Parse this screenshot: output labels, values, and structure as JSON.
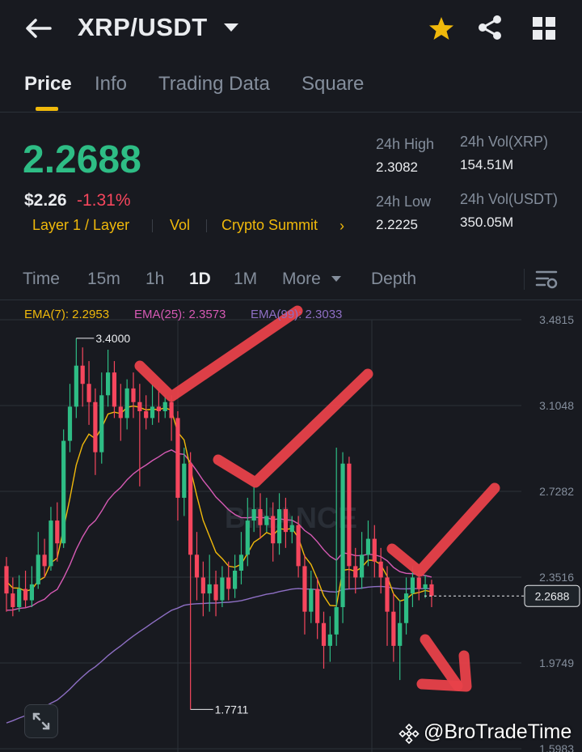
{
  "header": {
    "pair": "XRP/USDT"
  },
  "tabs": [
    "Price",
    "Info",
    "Trading Data",
    "Square"
  ],
  "price": {
    "last": "2.2688",
    "usd": "$2.26",
    "change": "-1.31%",
    "tags": [
      "Layer 1 / Layer",
      "Vol",
      "Crypto Summit"
    ]
  },
  "stats": {
    "high_label": "24h High",
    "high": "2.3082",
    "low_label": "24h Low",
    "low": "2.2225",
    "vol_base_label": "24h Vol(XRP)",
    "vol_base": "154.51M",
    "vol_quote_label": "24h Vol(USDT)",
    "vol_quote": "350.05M"
  },
  "intervals": [
    "Time",
    "15m",
    "1h",
    "1D",
    "1M",
    "More",
    "Depth"
  ],
  "active_interval": "1D",
  "ema": {
    "ema7": "EMA(7): 2.2953",
    "ema25": "EMA(25): 2.3573",
    "ema99": "EMA(99): 2.3033"
  },
  "colors": {
    "up": "#2ebd85",
    "down": "#f6465d",
    "accent": "#f0b90b",
    "annot": "#e8414a"
  },
  "chart_data": {
    "type": "candlestick",
    "y_ticks": [
      "3.4815",
      "3.1048",
      "2.7282",
      "2.3516",
      "1.9749",
      "1.5983"
    ],
    "ylim": [
      1.5983,
      3.4815
    ],
    "high_label": "3.4000",
    "low_label": "1.7711",
    "current_price": "2.2688",
    "watermark": "BINANCE",
    "candles": [
      [
        2.4,
        2.28,
        2.44,
        2.2
      ],
      [
        2.28,
        2.22,
        2.35,
        2.18
      ],
      [
        2.22,
        2.3,
        2.36,
        2.2
      ],
      [
        2.3,
        2.25,
        2.38,
        2.22
      ],
      [
        2.25,
        2.32,
        2.4,
        2.22
      ],
      [
        2.32,
        2.45,
        2.55,
        2.3
      ],
      [
        2.45,
        2.4,
        2.52,
        2.35
      ],
      [
        2.4,
        2.6,
        2.66,
        2.38
      ],
      [
        2.6,
        2.5,
        2.68,
        2.42
      ],
      [
        2.5,
        2.95,
        3.0,
        2.48
      ],
      [
        2.95,
        3.1,
        3.2,
        2.9
      ],
      [
        3.1,
        3.28,
        3.4,
        3.05
      ],
      [
        3.28,
        3.2,
        3.36,
        3.1
      ],
      [
        3.2,
        3.12,
        3.3,
        3.02
      ],
      [
        3.12,
        2.9,
        3.18,
        2.8
      ],
      [
        2.9,
        3.15,
        3.25,
        2.85
      ],
      [
        3.15,
        3.25,
        3.35,
        3.1
      ],
      [
        3.25,
        3.1,
        3.3,
        3.05
      ],
      [
        3.1,
        3.05,
        3.2,
        2.95
      ],
      [
        3.05,
        3.18,
        3.22,
        3.0
      ],
      [
        3.18,
        3.12,
        3.25,
        3.05
      ],
      [
        3.12,
        3.08,
        3.2,
        2.75
      ],
      [
        3.08,
        3.05,
        3.15,
        3.0
      ],
      [
        3.05,
        3.1,
        3.2,
        3.02
      ],
      [
        3.1,
        3.08,
        3.18,
        3.03
      ],
      [
        3.08,
        3.12,
        3.15,
        3.05
      ],
      [
        3.12,
        3.05,
        3.15,
        2.95
      ],
      [
        3.05,
        2.7,
        3.08,
        2.6
      ],
      [
        2.7,
        2.85,
        2.92,
        2.62
      ],
      [
        2.85,
        2.45,
        2.9,
        1.77
      ],
      [
        2.45,
        2.35,
        2.55,
        2.25
      ],
      [
        2.35,
        2.28,
        2.42,
        2.18
      ],
      [
        2.28,
        2.32,
        2.45,
        2.2
      ],
      [
        2.32,
        2.25,
        2.38,
        2.18
      ],
      [
        2.25,
        2.35,
        2.4,
        2.22
      ],
      [
        2.35,
        2.3,
        2.42,
        2.25
      ],
      [
        2.3,
        2.38,
        2.45,
        2.26
      ],
      [
        2.38,
        2.45,
        2.55,
        2.32
      ],
      [
        2.45,
        2.6,
        2.7,
        2.4
      ],
      [
        2.6,
        2.65,
        2.75,
        2.55
      ],
      [
        2.65,
        2.58,
        2.72,
        2.52
      ],
      [
        2.58,
        2.62,
        2.7,
        2.55
      ],
      [
        2.62,
        2.5,
        2.68,
        2.42
      ],
      [
        2.5,
        2.65,
        2.72,
        2.45
      ],
      [
        2.65,
        2.55,
        2.7,
        2.48
      ],
      [
        2.55,
        2.58,
        2.62,
        2.5
      ],
      [
        2.58,
        2.4,
        2.62,
        2.35
      ],
      [
        2.4,
        2.2,
        2.45,
        2.1
      ],
      [
        2.2,
        2.3,
        2.38,
        2.15
      ],
      [
        2.3,
        2.15,
        2.35,
        2.08
      ],
      [
        2.15,
        2.05,
        2.2,
        1.95
      ],
      [
        2.05,
        2.1,
        2.18,
        1.98
      ],
      [
        2.1,
        2.22,
        2.92,
        2.05
      ],
      [
        2.22,
        2.85,
        2.9,
        2.15
      ],
      [
        2.85,
        2.4,
        2.88,
        2.3
      ],
      [
        2.4,
        2.35,
        2.48,
        2.28
      ],
      [
        2.35,
        2.45,
        2.55,
        2.3
      ],
      [
        2.45,
        2.52,
        2.6,
        2.4
      ],
      [
        2.52,
        2.42,
        2.58,
        2.35
      ],
      [
        2.42,
        2.35,
        2.48,
        2.28
      ],
      [
        2.35,
        2.2,
        2.4,
        2.05
      ],
      [
        2.2,
        2.05,
        2.28,
        1.98
      ],
      [
        2.05,
        2.15,
        2.25,
        1.9
      ],
      [
        2.15,
        2.28,
        2.35,
        2.1
      ],
      [
        2.28,
        2.35,
        2.4,
        2.22
      ],
      [
        2.35,
        2.3,
        2.38,
        2.25
      ],
      [
        2.3,
        2.32,
        2.36,
        2.26
      ],
      [
        2.32,
        2.27,
        2.34,
        2.22
      ]
    ]
  }
}
